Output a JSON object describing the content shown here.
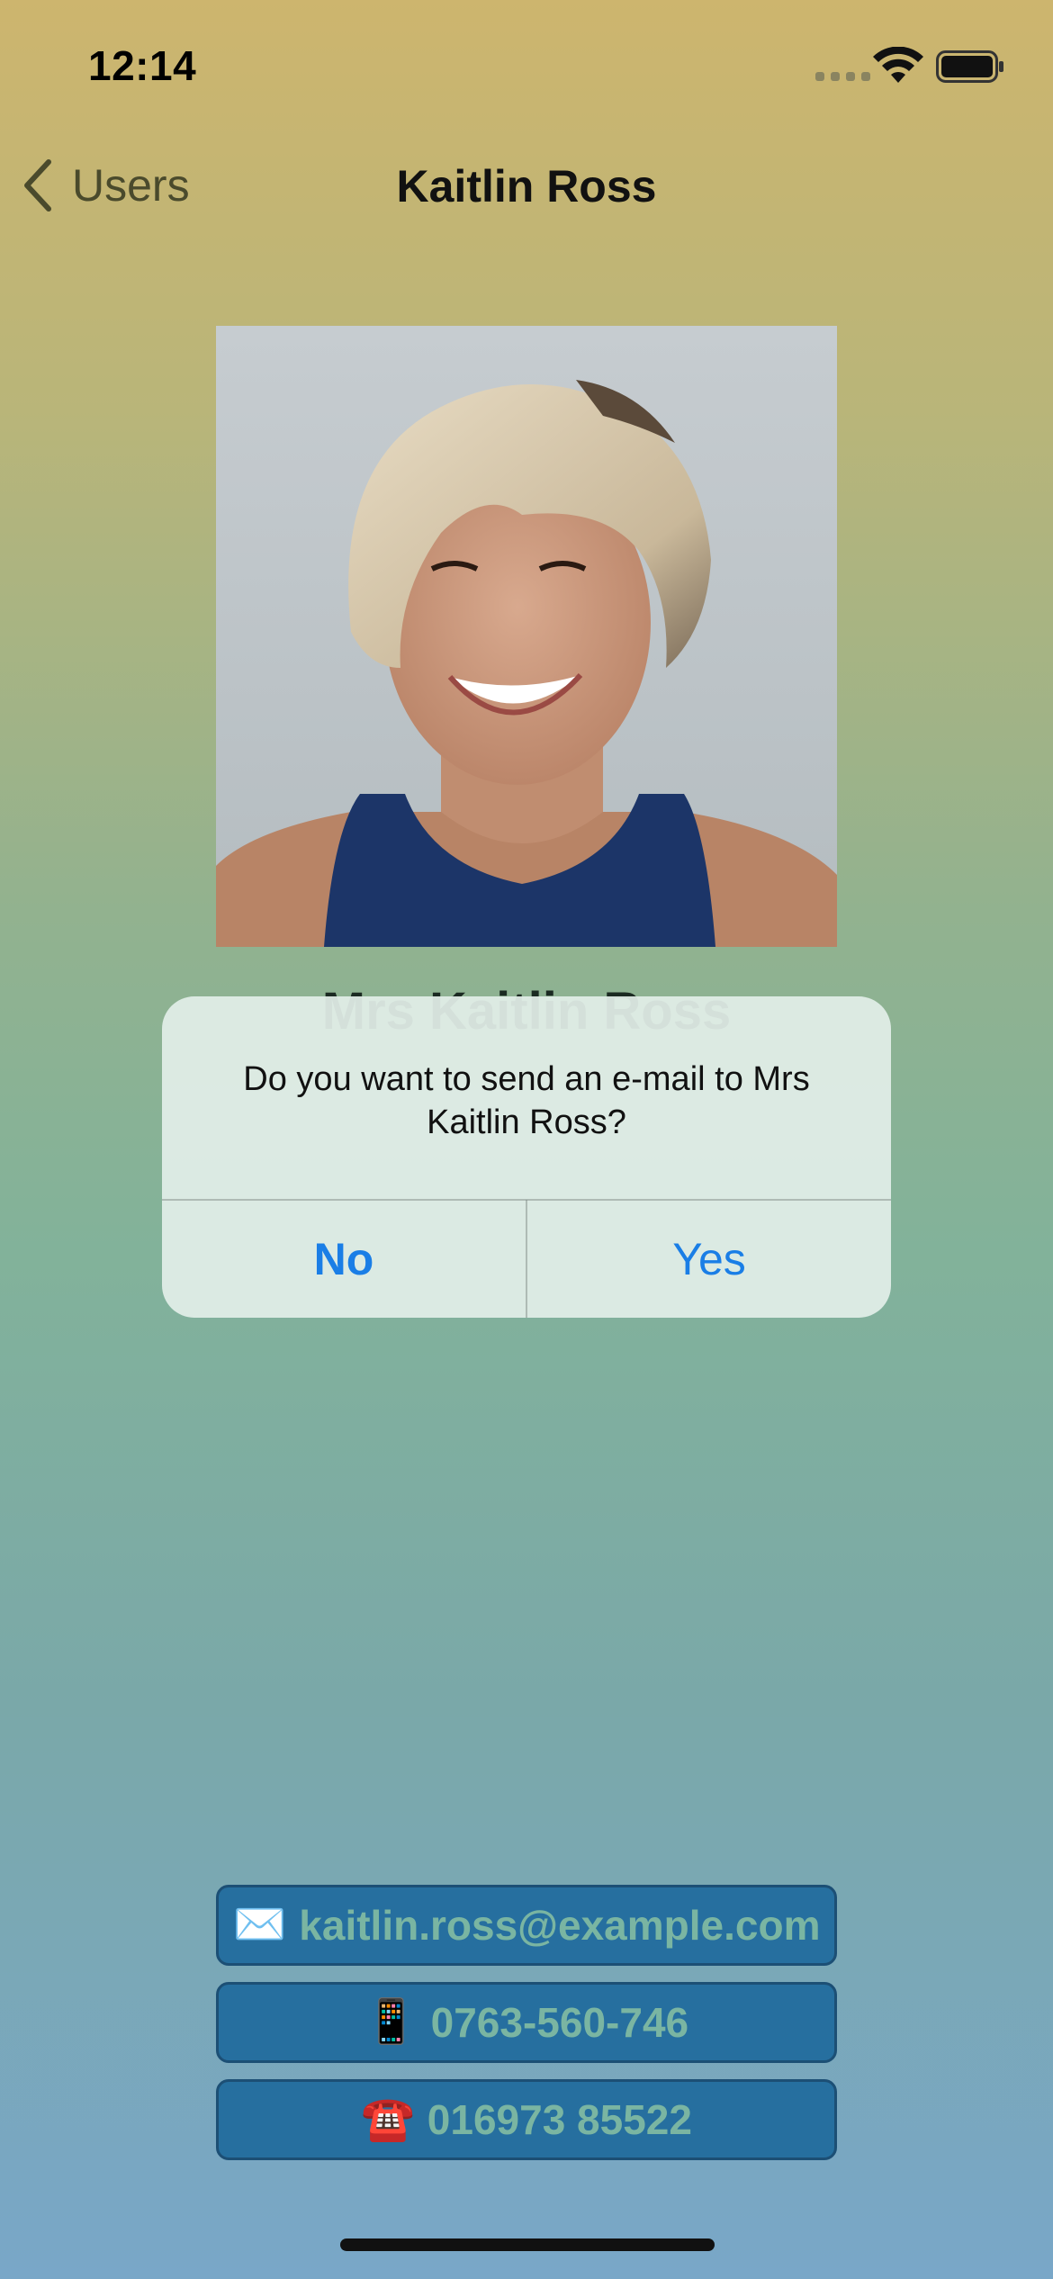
{
  "status_bar": {
    "time": "12:14"
  },
  "nav": {
    "back_label": "Users",
    "title": "Kaitlin Ross"
  },
  "profile": {
    "name": "Mrs Kaitlin Ross"
  },
  "alert": {
    "message": "Do you want to send an e-mail to Mrs Kaitlin Ross?",
    "no_label": "No",
    "yes_label": "Yes"
  },
  "contacts": {
    "email_icon": "✉️",
    "email": "kaitlin.ross@example.com",
    "mobile_icon": "📱",
    "mobile": "0763-560-746",
    "phone_icon": "☎️",
    "phone": "016973 85522"
  },
  "colors": {
    "accent": "#1a7ee6",
    "button_bg": "#266f9f",
    "button_text": "#7ab5a2"
  }
}
